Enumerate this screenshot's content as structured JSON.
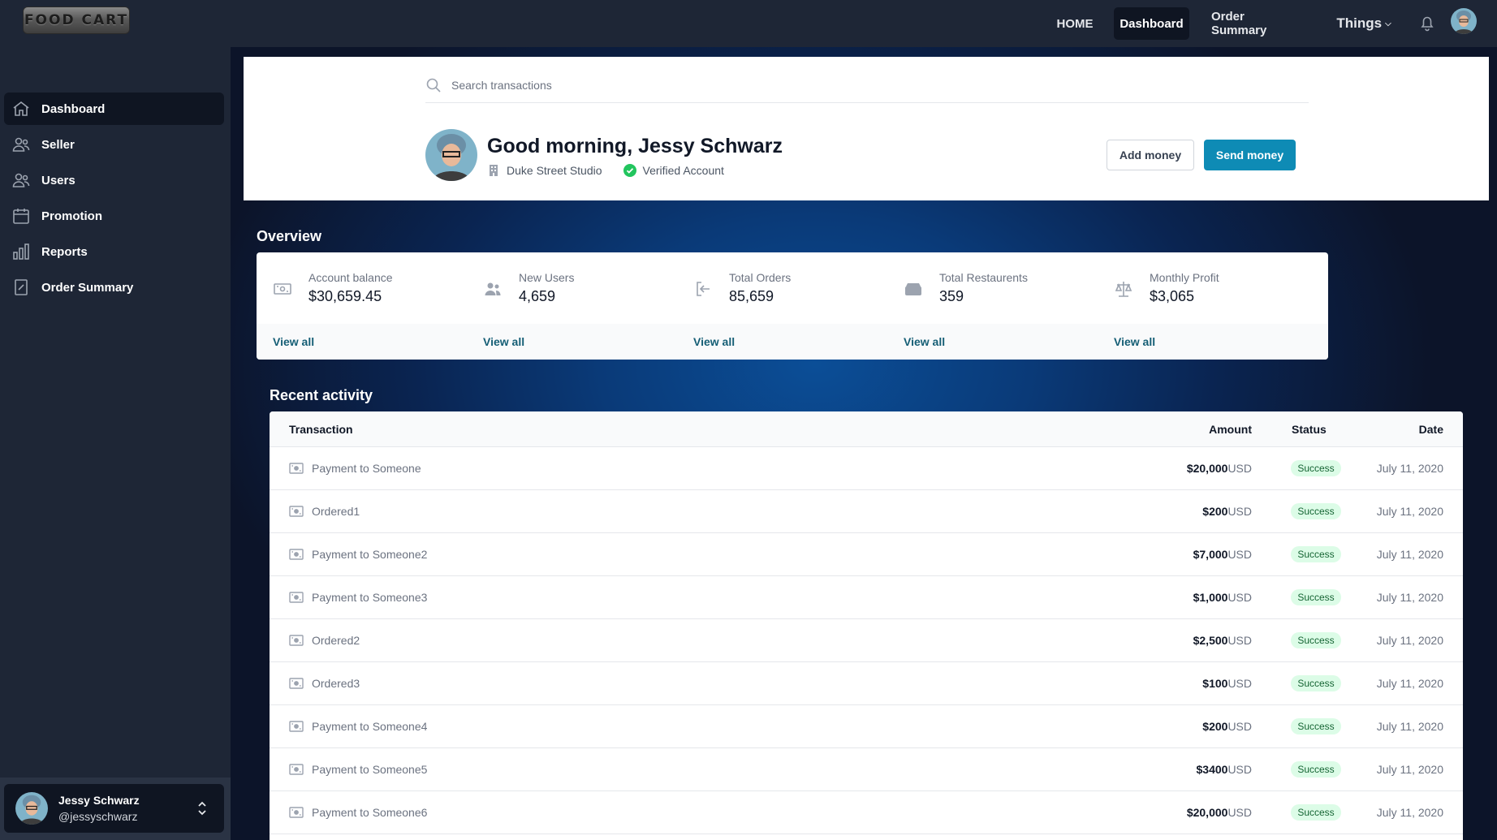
{
  "app": {
    "logo_text": "FOOD CART"
  },
  "topnav": {
    "home": "HOME",
    "dashboard": "Dashboard",
    "order_summary": "Order Summary",
    "things": "Things"
  },
  "sidebar": {
    "items": [
      {
        "label": "Dashboard",
        "icon": "home-icon",
        "active": true
      },
      {
        "label": "Seller",
        "icon": "users-icon"
      },
      {
        "label": "Users",
        "icon": "users-icon"
      },
      {
        "label": "Promotion",
        "icon": "calendar-icon"
      },
      {
        "label": "Reports",
        "icon": "bar-chart-icon"
      },
      {
        "label": "Order Summary",
        "icon": "receipt-icon"
      }
    ],
    "profile": {
      "name": "Jessy Schwarz",
      "handle": "@jessyschwarz"
    }
  },
  "header": {
    "search_placeholder": "Search transactions",
    "greeting": "Good morning, Jessy Schwarz",
    "company": "Duke Street Studio",
    "verified": "Verified Account",
    "add_money": "Add money",
    "send_money": "Send money"
  },
  "overview": {
    "title": "Overview",
    "cards": [
      {
        "label": "Account balance",
        "value": "$30,659.45",
        "link": "View all",
        "icon": "cash-icon"
      },
      {
        "label": "New Users",
        "value": "4,659",
        "link": "View all",
        "icon": "users-icon"
      },
      {
        "label": "Total Orders",
        "value": "85,659",
        "link": "View all",
        "icon": "login-icon"
      },
      {
        "label": "Total Restaurents",
        "value": "359",
        "link": "View all",
        "icon": "inbox-icon"
      },
      {
        "label": "Monthly Profit",
        "value": "$3,065",
        "link": "View all",
        "icon": "scale-icon"
      }
    ]
  },
  "recent": {
    "title": "Recent activity",
    "columns": {
      "transaction": "Transaction",
      "amount": "Amount",
      "status": "Status",
      "date": "Date"
    },
    "rows": [
      {
        "name": "Payment to Someone",
        "amount": "$20,000",
        "currency": "USD",
        "status": "Success",
        "date": "July 11, 2020"
      },
      {
        "name": "Ordered1",
        "amount": "$200",
        "currency": "USD",
        "status": "Success",
        "date": "July 11, 2020"
      },
      {
        "name": "Payment to Someone2",
        "amount": "$7,000",
        "currency": "USD",
        "status": "Success",
        "date": "July 11, 2020"
      },
      {
        "name": "Payment to Someone3",
        "amount": "$1,000",
        "currency": "USD",
        "status": "Success",
        "date": "July 11, 2020"
      },
      {
        "name": "Ordered2",
        "amount": "$2,500",
        "currency": "USD",
        "status": "Success",
        "date": "July 11, 2020"
      },
      {
        "name": "Ordered3",
        "amount": "$100",
        "currency": "USD",
        "status": "Success",
        "date": "July 11, 2020"
      },
      {
        "name": "Payment to Someone4",
        "amount": "$200",
        "currency": "USD",
        "status": "Success",
        "date": "July 11, 2020"
      },
      {
        "name": "Payment to Someone5",
        "amount": "$3400",
        "currency": "USD",
        "status": "Success",
        "date": "July 11, 2020"
      },
      {
        "name": "Payment to Someone6",
        "amount": "$20,000",
        "currency": "USD",
        "status": "Success",
        "date": "July 11, 2020"
      }
    ]
  },
  "colors": {
    "accent": "#0e8bb5",
    "sidebar_bg": "#1e2636",
    "success_bg": "#dcfce7",
    "success_text": "#166534"
  }
}
